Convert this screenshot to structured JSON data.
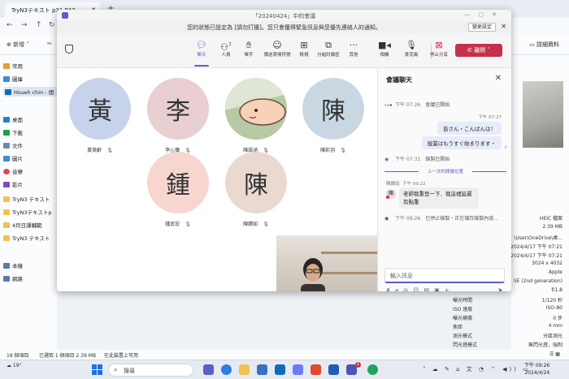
{
  "explorer": {
    "tab_title": "TryN3テキスト p31 P43",
    "toolbar": {
      "new_label": "新增",
      "details_label": "詳細資料"
    },
    "sidebar": [
      {
        "label": "常用"
      },
      {
        "label": "圖庫"
      },
      {
        "label": "Hsueh chin - 個"
      },
      {
        "label": "桌面"
      },
      {
        "label": "下載"
      },
      {
        "label": "文件"
      },
      {
        "label": "圖片"
      },
      {
        "label": "音樂"
      },
      {
        "label": "影片"
      },
      {
        "label": "TryN3 テキスト"
      },
      {
        "label": "TryN3テキストp"
      },
      {
        "label": "4月日課輔範"
      },
      {
        "label": "TryN3 テキスト"
      },
      {
        "label": "本機"
      },
      {
        "label": "網路"
      }
    ],
    "details": [
      {
        "k": "",
        "v": "HEIC 檔案"
      },
      {
        "k": "",
        "v": "2.39 MB"
      },
      {
        "k": "",
        "v": "\\User\\OneDrive\\桌..."
      },
      {
        "k": "",
        "v": "2024/4/17 下午 07:21"
      },
      {
        "k": "",
        "v": "2024/4/17 下午 07:21"
      },
      {
        "k": "",
        "v": "3024 x 4032"
      },
      {
        "k": "",
        "v": "Apple"
      },
      {
        "k": "",
        "v": "SE (2nd generation)"
      },
      {
        "k": "",
        "v": "f/1.8"
      },
      {
        "k": "曝光時間",
        "v": "1/120 秒"
      },
      {
        "k": "ISO 速度",
        "v": "ISO-80"
      },
      {
        "k": "曝光補償",
        "v": "0 步"
      },
      {
        "k": "焦距",
        "v": "4 mm"
      },
      {
        "k": "測光模式",
        "v": "分區測光"
      },
      {
        "k": "閃光燈模式",
        "v": "無閃光燈，強制"
      }
    ],
    "status": {
      "items": "18 個項目",
      "selected": "已選取 1 個項目 2.39 MB",
      "available": "在此裝置上可用"
    }
  },
  "taskbar": {
    "weather": "19°",
    "search_placeholder": "搜尋",
    "badge": "1",
    "time": "下午 09:26",
    "date": "2024/4/24"
  },
  "teams": {
    "title": "「20240424」中的會議",
    "banner": "您的狀態已設定為 [請勿打擾]。您只會獲得緊急訊息與您優先連絡人的通知。",
    "banner_button": "變更設定",
    "toolbar": {
      "chat": "聊天",
      "people": "人員",
      "people_count": "7",
      "raise": "舉手",
      "react": "傳送表情符號",
      "view": "檢視",
      "rooms": "分組討論區",
      "more": "其他",
      "camera": "相機",
      "mic": "麥克風",
      "stop_share": "停止分享",
      "leave": "離開"
    },
    "participants": [
      {
        "initial": "黃",
        "name": "黃美齡",
        "bg": "#c7d3ea"
      },
      {
        "initial": "李",
        "name": "李心儀",
        "bg": "#e9cfd2"
      },
      {
        "initial": "",
        "name": "陳語涵",
        "bg": "#a9c4a2"
      },
      {
        "initial": "陳",
        "name": "陳彩羽",
        "bg": "#c9d7e2"
      },
      {
        "initial": "鍾",
        "name": "鍾武宏",
        "bg": "#f6d6cf"
      },
      {
        "initial": "陳",
        "name": "陳鑽如",
        "bg": "#ead9d1"
      }
    ],
    "chat": {
      "header": "會議聊天",
      "sys1_time": "下午 07:26",
      "sys1_text": "會議已開始",
      "me_time": "下午 07:27",
      "me_msg1": "皆さん・こんばんは！",
      "me_msg2": "授業はもうすぐ始まります・",
      "sys2_time": "下午 07:31",
      "sys2_text": "錄製已開始",
      "unread": "上一次的閱讀位置",
      "other_name": "陳鑽如",
      "other_time": "下午 09:22",
      "other_msg": "老師我重登一下．我這裡延遲有點重",
      "sys3_time": "下午 09:26",
      "sys3_text": "已停止錄製・正在儲存錄製內容...",
      "input_placeholder": "輸入訊息"
    }
  }
}
